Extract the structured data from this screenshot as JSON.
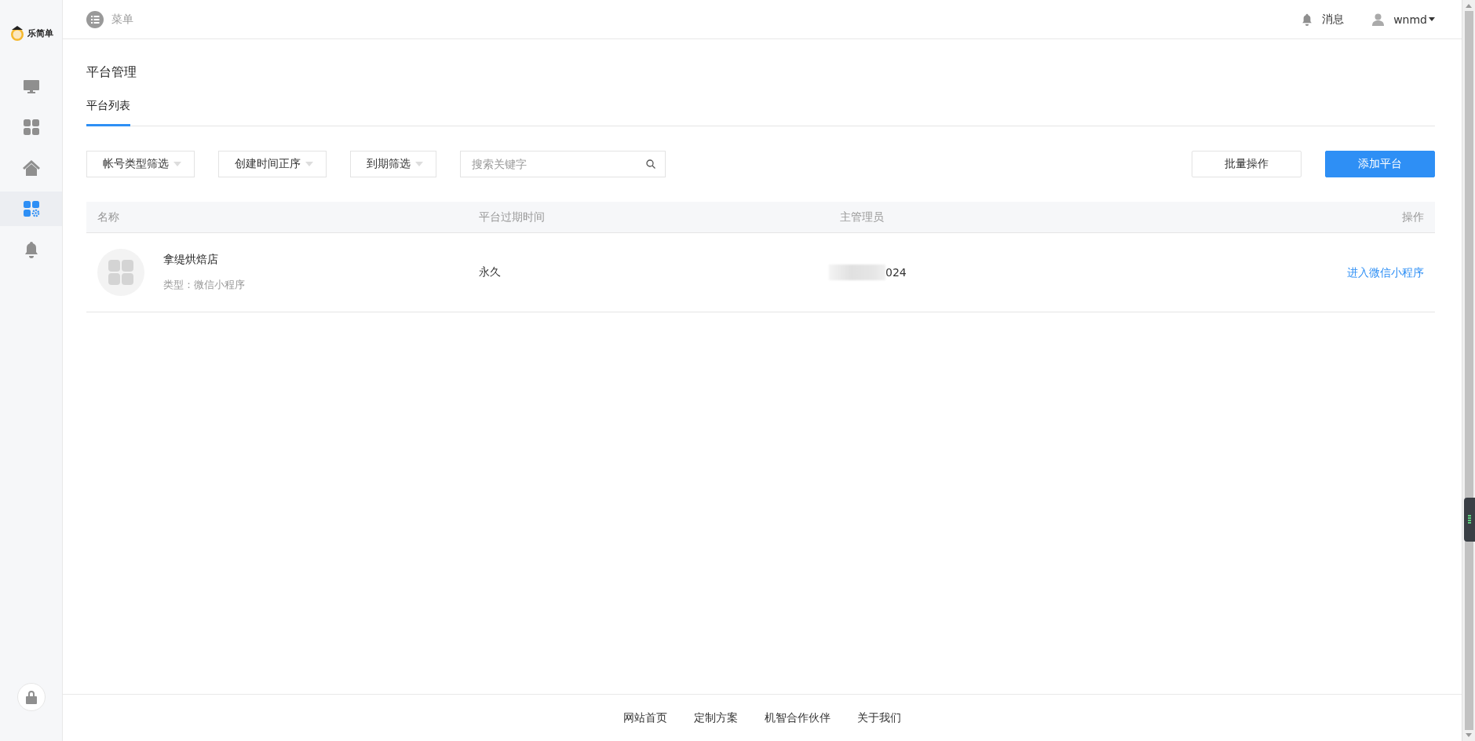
{
  "sidebar": {
    "logo": "乐简单",
    "items": [
      {
        "kind": "monitor",
        "selected": false
      },
      {
        "kind": "apps",
        "selected": false
      },
      {
        "kind": "home",
        "selected": false
      },
      {
        "kind": "apps-settings",
        "selected": true
      },
      {
        "kind": "bell",
        "selected": false
      }
    ]
  },
  "header": {
    "menu_label": "菜单",
    "notifications_label": "消息",
    "username": "wnmd"
  },
  "page_title": "平台管理",
  "tabs": [
    {
      "label": "平台列表",
      "selected": true
    }
  ],
  "filters": [
    "帐号类型筛选",
    "创建时间正序",
    "到期筛选"
  ],
  "search": {
    "placeholder": "搜索关键字"
  },
  "actions": [
    {
      "label": "批量操作",
      "kind": "default"
    },
    {
      "label": "添加平台",
      "kind": "primary"
    }
  ],
  "table": {
    "columns": [
      "名称",
      "平台过期时间",
      "主管理员",
      "操作"
    ],
    "rows": [
      {
        "name": "拿缇烘焙店",
        "type": "类型：微信小程序",
        "expiry": "永久",
        "admin": "024",
        "admin_redacted": true,
        "action": "进入微信小程序"
      }
    ]
  },
  "footer": {
    "links": [
      "网站首页",
      "定制方案",
      "机智合作伙伴",
      "关于我们"
    ]
  }
}
